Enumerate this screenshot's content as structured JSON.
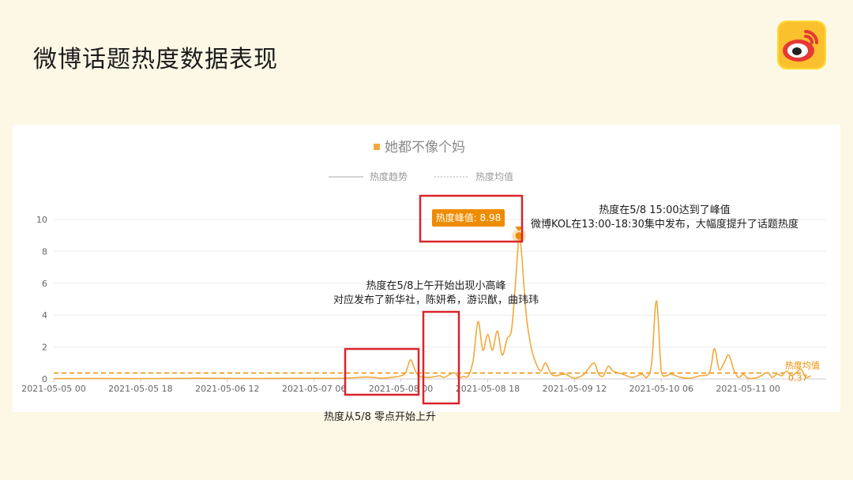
{
  "slide": {
    "title": "微博话题热度数据表现"
  },
  "annotations": {
    "start_rise": "热度从5/8 零点开始上升",
    "morning_peak_line1": "热度在5/8上午开始出现小高峰",
    "morning_peak_line2": "对应发布了新华社，陈妍希，游识猷，曲玮玮",
    "peak_line1": "热度在5/8 15:00达到了峰值",
    "peak_line2": "微博KOL在13:00-18:30集中发布，大幅度提升了话题热度"
  },
  "colors": {
    "line": "#f2a93b",
    "accent": "#ee8c00",
    "highlight_box": "#d9242b",
    "grid": "#ececec",
    "axis_text": "#666666"
  },
  "chart_data": {
    "type": "line",
    "title": "她都不像个妈",
    "legend": [
      "热度趋势",
      "热度均值"
    ],
    "x_tick_labels": [
      "2021-05-05 00",
      "2021-05-05 18",
      "2021-05-06 12",
      "2021-05-07 06",
      "2021-05-08 00",
      "2021-05-08 18",
      "2021-05-09 12",
      "2021-05-10 06",
      "2021-05-11 00"
    ],
    "y_ticks": [
      0,
      2,
      4,
      6,
      8,
      10
    ],
    "ylim": [
      0,
      10
    ],
    "x_hours_range": [
      0,
      152
    ],
    "series": [
      {
        "name": "热度趋势",
        "points": [
          [
            0,
            0.02
          ],
          [
            10,
            0.03
          ],
          [
            20,
            0.02
          ],
          [
            30,
            0.05
          ],
          [
            40,
            0.03
          ],
          [
            50,
            0.04
          ],
          [
            60,
            0.05
          ],
          [
            65,
            0.12
          ],
          [
            68,
            0.05
          ],
          [
            70,
            0.1
          ],
          [
            72,
            0.2
          ],
          [
            73,
            0.4
          ],
          [
            74,
            1.2
          ],
          [
            75,
            0.5
          ],
          [
            76,
            0.15
          ],
          [
            78,
            0.1
          ],
          [
            80,
            0.2
          ],
          [
            81,
            0.1
          ],
          [
            83,
            0.4
          ],
          [
            84,
            0.1
          ],
          [
            85,
            0.15
          ],
          [
            86,
            0.2
          ],
          [
            87,
            1.2
          ],
          [
            88,
            3.6
          ],
          [
            89,
            1.8
          ],
          [
            90,
            2.8
          ],
          [
            91,
            1.8
          ],
          [
            92,
            3.0
          ],
          [
            93,
            1.5
          ],
          [
            94,
            2.5
          ],
          [
            95,
            3.2
          ],
          [
            96,
            7.0
          ],
          [
            96.5,
            8.98
          ],
          [
            97,
            8.0
          ],
          [
            98,
            4.0
          ],
          [
            99,
            2.0
          ],
          [
            100,
            1.0
          ],
          [
            101,
            0.5
          ],
          [
            102,
            1.0
          ],
          [
            103,
            0.4
          ],
          [
            104,
            0.2
          ],
          [
            106,
            0.3
          ],
          [
            108,
            0.05
          ],
          [
            110,
            0.3
          ],
          [
            112,
            1.0
          ],
          [
            113,
            0.3
          ],
          [
            114,
            0.2
          ],
          [
            115,
            0.8
          ],
          [
            116,
            0.5
          ],
          [
            118,
            0.3
          ],
          [
            120,
            0.1
          ],
          [
            122,
            0.3
          ],
          [
            123,
            0.1
          ],
          [
            124,
            1.0
          ],
          [
            125,
            4.9
          ],
          [
            126,
            0.5
          ],
          [
            127,
            0.2
          ],
          [
            128,
            0.3
          ],
          [
            130,
            0.1
          ],
          [
            132,
            0.05
          ],
          [
            134,
            0.2
          ],
          [
            136,
            0.4
          ],
          [
            137,
            1.9
          ],
          [
            138,
            0.6
          ],
          [
            139,
            1.0
          ],
          [
            140,
            1.5
          ],
          [
            141,
            0.6
          ],
          [
            142,
            0.1
          ],
          [
            143,
            0.3
          ],
          [
            144,
            0.05
          ],
          [
            146,
            0.1
          ],
          [
            148,
            0.4
          ],
          [
            149,
            0.1
          ],
          [
            150,
            0.3
          ],
          [
            151,
            0.2
          ],
          [
            152,
            0.5
          ],
          [
            153,
            0.2
          ],
          [
            154,
            0.4
          ],
          [
            155,
            0.6
          ],
          [
            156,
            0.1
          ],
          [
            157,
            0.2
          ]
        ]
      }
    ],
    "mean_value": 0.37,
    "mean_label": "热度均值",
    "peak": {
      "x_hours": 96.5,
      "value": 8.98,
      "label": "热度峰值: 8.98"
    }
  }
}
